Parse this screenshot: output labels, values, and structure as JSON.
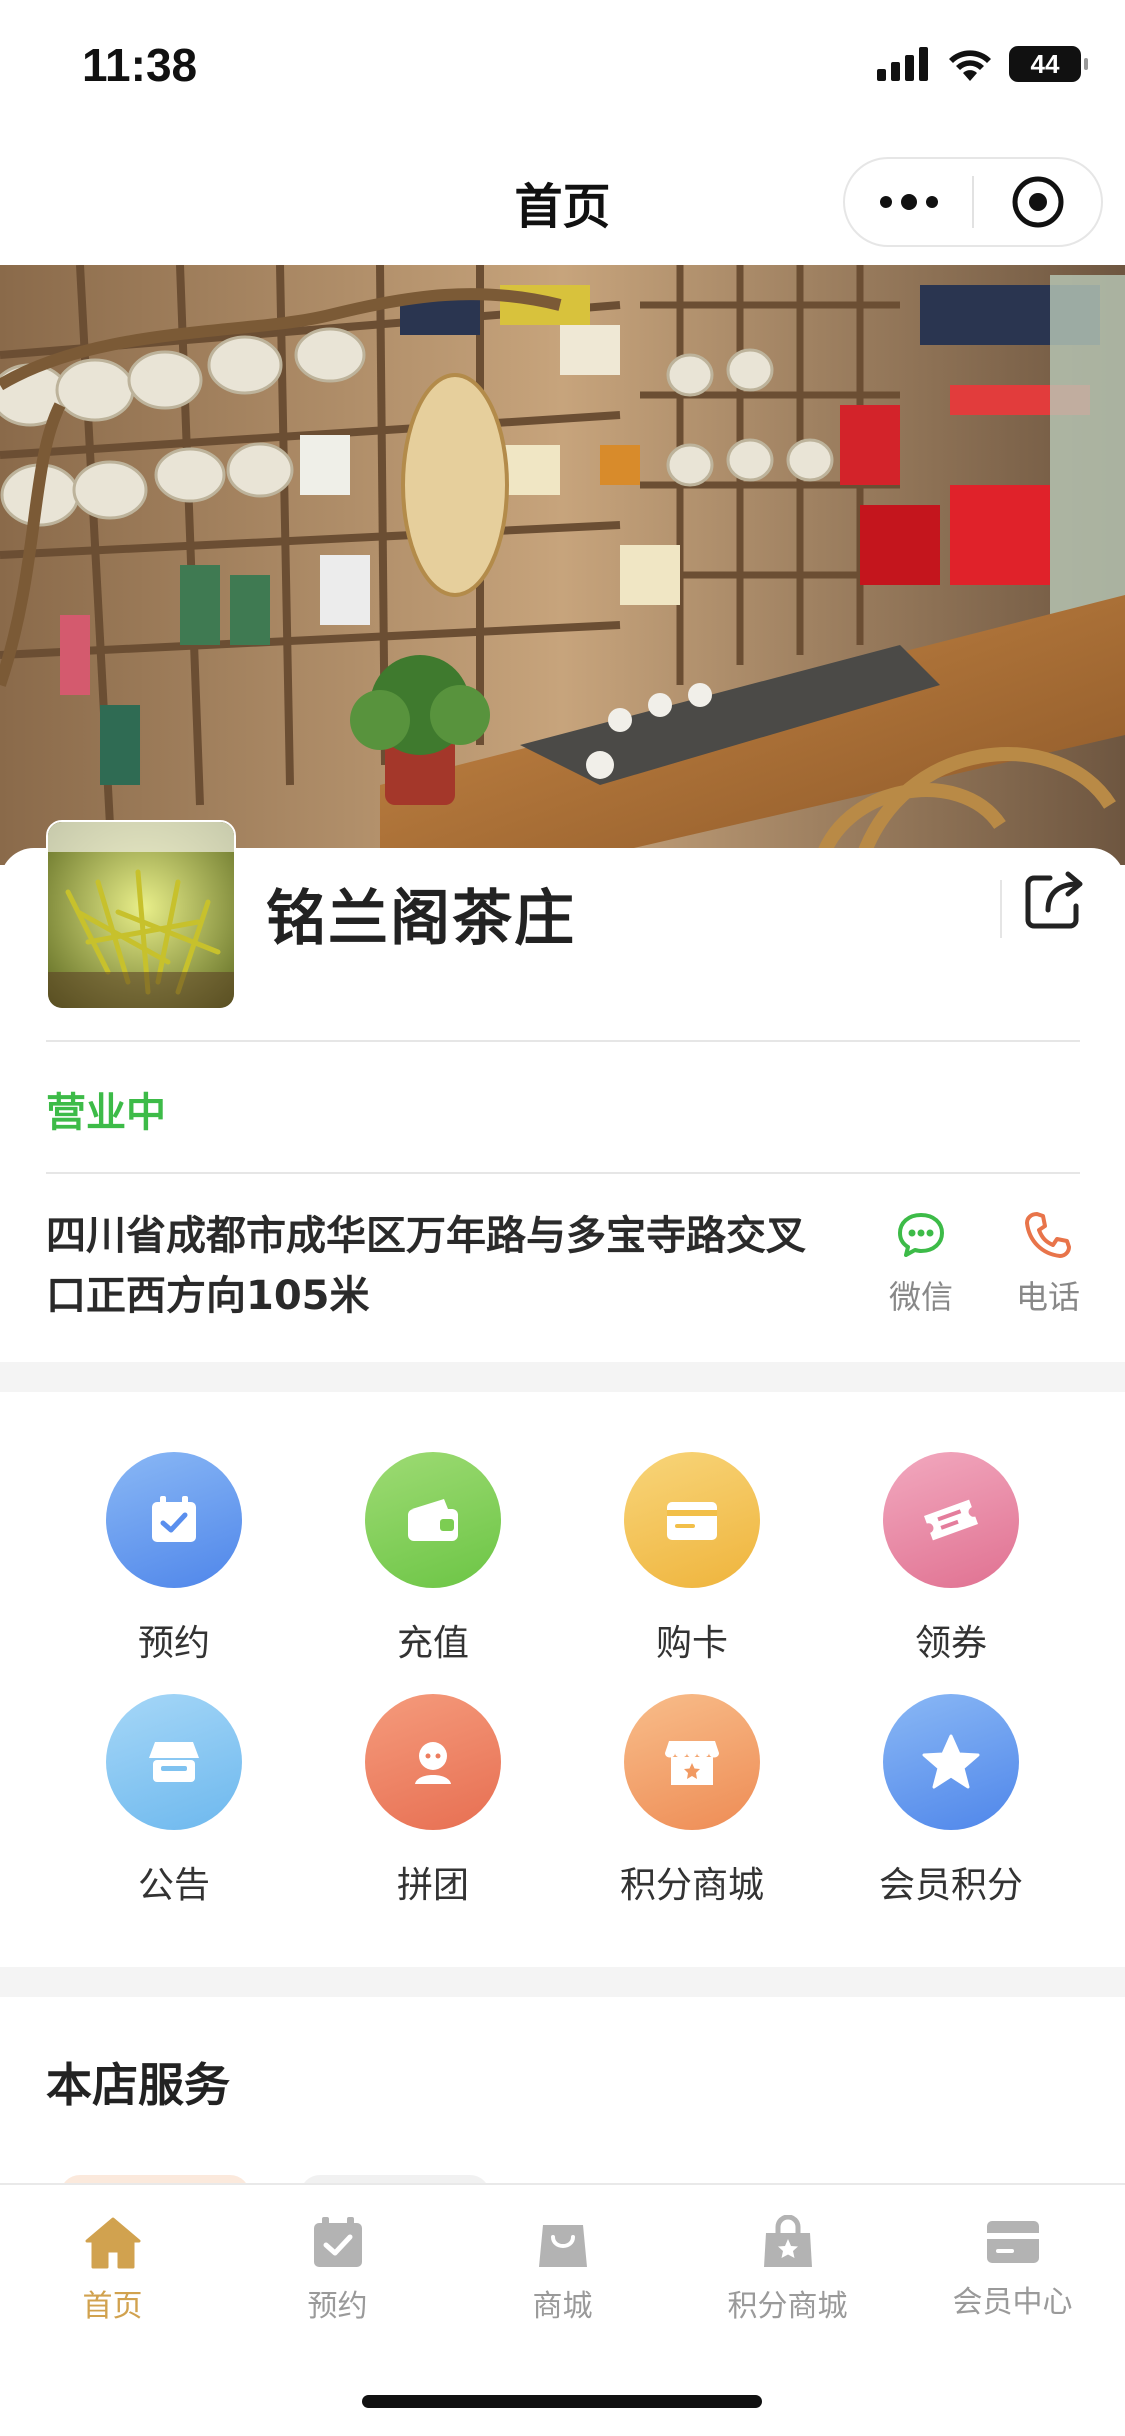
{
  "status_bar": {
    "time": "11:38",
    "battery": "44"
  },
  "nav": {
    "title": "首页"
  },
  "store": {
    "name": "铭兰阁茶庄",
    "status": "营业中",
    "address": "四川省成都市成华区万年路与多宝寺路交叉口正西方向105米",
    "contacts": [
      {
        "label": "微信",
        "icon": "wechat-icon",
        "color": "#3dbb48"
      },
      {
        "label": "电话",
        "icon": "phone-icon",
        "color": "#e8744a"
      }
    ]
  },
  "grid_items": [
    {
      "label": "预约",
      "icon": "calendar-check-icon",
      "color_from": "#8ab8f5",
      "color_to": "#4f86ea"
    },
    {
      "label": "充值",
      "icon": "wallet-icon",
      "color_from": "#9edb74",
      "color_to": "#6cc545"
    },
    {
      "label": "购卡",
      "icon": "card-icon",
      "color_from": "#f8d57a",
      "color_to": "#efb43c"
    },
    {
      "label": "领券",
      "icon": "ticket-icon",
      "color_from": "#f2a9bf",
      "color_to": "#e07191"
    },
    {
      "label": "公告",
      "icon": "notice-icon",
      "color_from": "#a6d7f7",
      "color_to": "#6db8ee"
    },
    {
      "label": "拼团",
      "icon": "group-icon",
      "color_from": "#f59b7c",
      "color_to": "#e76f52"
    },
    {
      "label": "积分商城",
      "icon": "store-icon",
      "color_from": "#f8bd8a",
      "color_to": "#ee8c55"
    },
    {
      "label": "会员积分",
      "icon": "star-icon",
      "color_from": "#8ab8f5",
      "color_to": "#4f86ea"
    }
  ],
  "services": {
    "title": "本店服务"
  },
  "tabbar": {
    "active_color": "#d1a24f",
    "inactive_color": "#9a9a9a",
    "items": [
      {
        "label": "首页",
        "icon": "home-icon"
      },
      {
        "label": "预约",
        "icon": "calendar-check-icon"
      },
      {
        "label": "商城",
        "icon": "shopping-bag-icon"
      },
      {
        "label": "积分商城",
        "icon": "points-bag-icon"
      },
      {
        "label": "会员中心",
        "icon": "member-card-icon"
      }
    ]
  }
}
